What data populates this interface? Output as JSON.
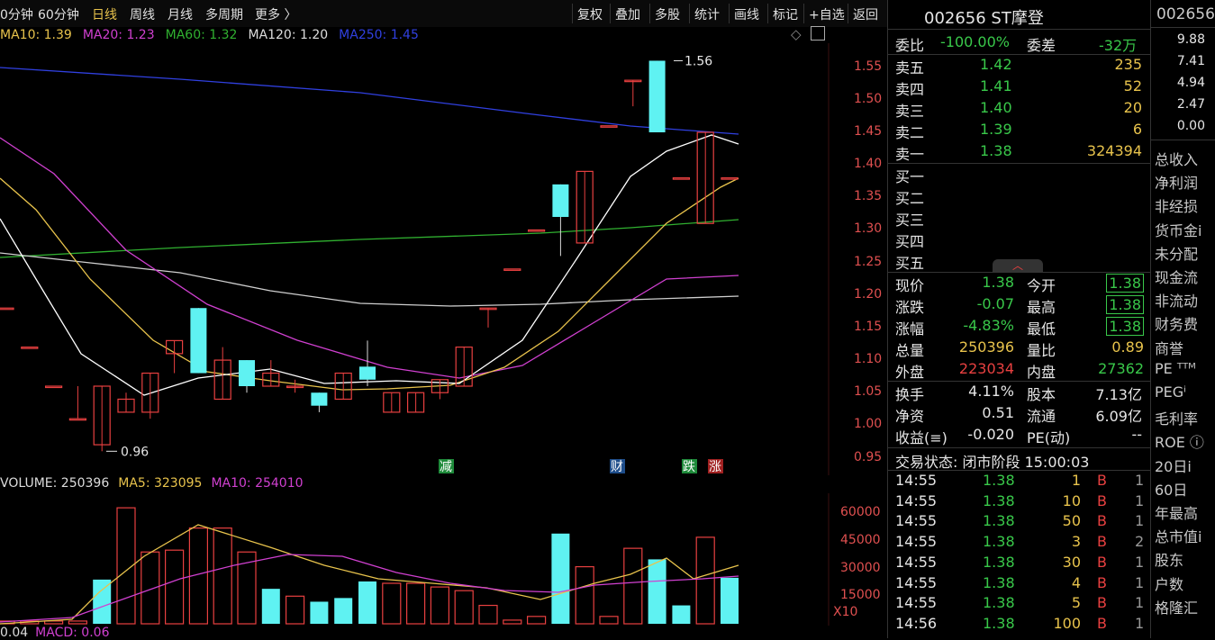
{
  "toolbar": {
    "periods": [
      "0分钟",
      "60分钟",
      "日线",
      "周线",
      "月线",
      "多周期",
      "更多 〉"
    ],
    "active": "日线",
    "tools": [
      "复权",
      "叠加",
      "多股",
      "统计",
      "画线",
      "标记",
      "+自选",
      "返回"
    ]
  },
  "ma_legend": [
    {
      "label": "MA10: 1.39",
      "color": "#e8c34c"
    },
    {
      "label": "MA20: 1.23",
      "color": "#d040d0"
    },
    {
      "label": "MA60: 1.32",
      "color": "#30b030"
    },
    {
      "label": "MA120: 1.20",
      "color": "#dddddd"
    },
    {
      "label": "MA250: 1.45",
      "color": "#3040e0"
    }
  ],
  "price_axis": [
    "1.55",
    "1.50",
    "1.45",
    "1.40",
    "1.35",
    "1.30",
    "1.25",
    "1.20",
    "1.15",
    "1.10",
    "1.05",
    "1.00",
    "0.95"
  ],
  "annotations": {
    "high": "1.56",
    "low": "0.96"
  },
  "event_tags": [
    {
      "text": "减",
      "color": "#1e8a3a"
    },
    {
      "text": "财",
      "color": "#1e4d8a"
    },
    {
      "text": "跌",
      "color": "#1e8a3a"
    },
    {
      "text": "涨",
      "color": "#a02020"
    }
  ],
  "volume_legend": [
    {
      "label": "VOLUME: 250396",
      "color": "#dddddd"
    },
    {
      "label": "MA5: 323095",
      "color": "#e8c34c"
    },
    {
      "label": "MA10: 254010",
      "color": "#d040d0"
    }
  ],
  "volume_axis": [
    "60000",
    "45000",
    "30000",
    "15000"
  ],
  "volume_unit": "X10",
  "macd_legend": [
    {
      "label": "0.04",
      "color": "#dddddd"
    },
    {
      "label": "MACD: 0.06",
      "color": "#d040d0"
    }
  ],
  "chart_data": {
    "type": "candlestick",
    "ylim": [
      0.93,
      1.58
    ],
    "candles": [
      {
        "o": 1.18,
        "h": 1.18,
        "l": 1.18,
        "c": 1.18
      },
      {
        "o": 1.12,
        "h": 1.12,
        "l": 1.12,
        "c": 1.12
      },
      {
        "o": 1.06,
        "h": 1.06,
        "l": 1.06,
        "c": 1.06
      },
      {
        "o": 1.01,
        "h": 1.06,
        "l": 1.01,
        "c": 1.01
      },
      {
        "o": 0.97,
        "h": 1.06,
        "l": 0.96,
        "c": 1.06
      },
      {
        "o": 1.02,
        "h": 1.05,
        "l": 1.02,
        "c": 1.04
      },
      {
        "o": 1.02,
        "h": 1.08,
        "l": 1.01,
        "c": 1.08
      },
      {
        "o": 1.11,
        "h": 1.13,
        "l": 1.08,
        "c": 1.13
      },
      {
        "o": 1.18,
        "h": 1.18,
        "l": 1.08,
        "c": 1.08
      },
      {
        "o": 1.04,
        "h": 1.12,
        "l": 1.04,
        "c": 1.1
      },
      {
        "o": 1.1,
        "h": 1.1,
        "l": 1.05,
        "c": 1.06
      },
      {
        "o": 1.06,
        "h": 1.1,
        "l": 1.06,
        "c": 1.08
      },
      {
        "o": 1.06,
        "h": 1.07,
        "l": 1.05,
        "c": 1.06
      },
      {
        "o": 1.05,
        "h": 1.05,
        "l": 1.02,
        "c": 1.03
      },
      {
        "o": 1.04,
        "h": 1.08,
        "l": 1.04,
        "c": 1.08
      },
      {
        "o": 1.09,
        "h": 1.13,
        "l": 1.06,
        "c": 1.07
      },
      {
        "o": 1.02,
        "h": 1.05,
        "l": 1.02,
        "c": 1.05
      },
      {
        "o": 1.02,
        "h": 1.05,
        "l": 1.02,
        "c": 1.05
      },
      {
        "o": 1.05,
        "h": 1.07,
        "l": 1.04,
        "c": 1.07
      },
      {
        "o": 1.06,
        "h": 1.12,
        "l": 1.06,
        "c": 1.12
      },
      {
        "o": 1.18,
        "h": 1.18,
        "l": 1.15,
        "c": 1.18
      },
      {
        "o": 1.24,
        "h": 1.24,
        "l": 1.24,
        "c": 1.24
      },
      {
        "o": 1.3,
        "h": 1.3,
        "l": 1.3,
        "c": 1.3
      },
      {
        "o": 1.37,
        "h": 1.37,
        "l": 1.26,
        "c": 1.32
      },
      {
        "o": 1.28,
        "h": 1.39,
        "l": 1.28,
        "c": 1.39
      },
      {
        "o": 1.46,
        "h": 1.46,
        "l": 1.46,
        "c": 1.46
      },
      {
        "o": 1.53,
        "h": 1.53,
        "l": 1.49,
        "c": 1.53
      },
      {
        "o": 1.56,
        "h": 1.56,
        "l": 1.45,
        "c": 1.45
      },
      {
        "o": 1.38,
        "h": 1.38,
        "l": 1.38,
        "c": 1.38
      },
      {
        "o": 1.31,
        "h": 1.45,
        "l": 1.31,
        "c": 1.45
      },
      {
        "o": 1.38,
        "h": 1.38,
        "l": 1.38,
        "c": 1.38
      }
    ],
    "volume": [
      1500,
      1500,
      1500,
      1500,
      24000,
      63000,
      39000,
      40000,
      52000,
      52000,
      39000,
      19000,
      15000,
      12000,
      14000,
      23000,
      22000,
      22000,
      20000,
      18000,
      10000,
      2000,
      4000,
      49000,
      31000,
      4000,
      41000,
      35000,
      10000,
      47000,
      25000
    ],
    "volume_up": [
      false,
      false,
      false,
      false,
      true,
      false,
      false,
      false,
      false,
      false,
      false,
      true,
      false,
      true,
      true,
      true,
      false,
      false,
      false,
      false,
      false,
      false,
      false,
      true,
      false,
      false,
      false,
      true,
      true,
      false,
      true
    ],
    "ylim_volume": [
      0,
      66000
    ]
  },
  "quote": {
    "title": "002656 ST摩登",
    "weibi_label": "委比",
    "weibi": "-100.00%",
    "weicha_label": "委差",
    "weicha": "-32万",
    "asks": [
      {
        "label": "卖五",
        "price": "1.42",
        "vol": "235"
      },
      {
        "label": "卖四",
        "price": "1.41",
        "vol": "52"
      },
      {
        "label": "卖三",
        "price": "1.40",
        "vol": "20"
      },
      {
        "label": "卖二",
        "price": "1.39",
        "vol": "6"
      },
      {
        "label": "卖一",
        "price": "1.38",
        "vol": "324394"
      }
    ],
    "bids": [
      "买一",
      "买二",
      "买三",
      "买四",
      "买五"
    ],
    "stats_left": [
      {
        "label": "现价",
        "value": "1.38"
      },
      {
        "label": "涨跌",
        "value": "-0.07"
      },
      {
        "label": "涨幅",
        "value": "-4.83%"
      },
      {
        "label": "总量",
        "value": "250396"
      },
      {
        "label": "外盘",
        "value": "223034"
      }
    ],
    "stats_right": [
      {
        "label": "今开",
        "value": "1.38"
      },
      {
        "label": "最高",
        "value": "1.38"
      },
      {
        "label": "最低",
        "value": "1.38"
      },
      {
        "label": "量比",
        "value": "0.89"
      },
      {
        "label": "内盘",
        "value": "27362"
      }
    ],
    "fin_left": [
      {
        "label": "换手",
        "value": "4.11%"
      },
      {
        "label": "净资",
        "value": "0.51"
      },
      {
        "label": "收益(≡)",
        "value": "-0.020"
      }
    ],
    "fin_right": [
      {
        "label": "股本",
        "value": "7.13亿"
      },
      {
        "label": "流通",
        "value": "6.09亿"
      },
      {
        "label": "PE(动)",
        "value": "--"
      }
    ],
    "status": "交易状态: 闭市阶段 15:00:03",
    "ticks": [
      {
        "t": "14:55",
        "p": "1.38",
        "v": "1",
        "d": "B",
        "n": "1"
      },
      {
        "t": "14:55",
        "p": "1.38",
        "v": "10",
        "d": "B",
        "n": "1"
      },
      {
        "t": "14:55",
        "p": "1.38",
        "v": "50",
        "d": "B",
        "n": "1"
      },
      {
        "t": "14:55",
        "p": "1.38",
        "v": "3",
        "d": "B",
        "n": "2"
      },
      {
        "t": "14:55",
        "p": "1.38",
        "v": "30",
        "d": "B",
        "n": "1"
      },
      {
        "t": "14:55",
        "p": "1.38",
        "v": "4",
        "d": "B",
        "n": "1"
      },
      {
        "t": "14:55",
        "p": "1.38",
        "v": "5",
        "d": "B",
        "n": "1"
      },
      {
        "t": "14:56",
        "p": "1.38",
        "v": "100",
        "d": "B",
        "n": "1"
      }
    ]
  },
  "far": {
    "code": "002656",
    "axis": [
      "9.88",
      "7.41",
      "4.94",
      "2.47",
      "0.00"
    ],
    "menu": [
      "总收入",
      "净利润",
      "非经损",
      "货币金i",
      "未分配",
      "现金流",
      "非流动",
      "财务费",
      "商誉",
      "PE ᵀᵀᴹ",
      "PEGⁱ",
      "毛利率",
      "ROE ⓘ",
      "20日i",
      "60日",
      "年最高",
      "总市值i",
      "股东",
      "户数",
      "格隆汇"
    ]
  }
}
